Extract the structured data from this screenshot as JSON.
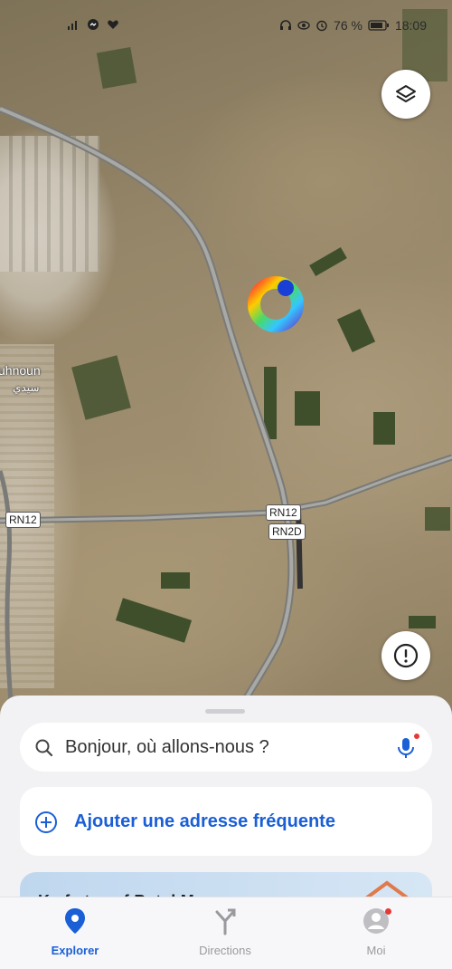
{
  "status_bar": {
    "battery": "76 %",
    "time": "18:09"
  },
  "map": {
    "place_name": "uhnoun",
    "place_name_ar": "سيدي",
    "road_labels": [
      "RN12",
      "RN12",
      "RN2D"
    ],
    "layers_icon": "layers-icon",
    "info_icon": "alert-info-icon"
  },
  "sheet": {
    "search_placeholder": "Bonjour, où allons-nous ?",
    "add_address": "Ajouter une adresse fréquente",
    "promo_text": "K...f...t... ...f B..t..l M..."
  },
  "nav": {
    "items": [
      {
        "label": "Explorer",
        "icon": "location-pin-icon"
      },
      {
        "label": "Directions",
        "icon": "directions-icon"
      },
      {
        "label": "Moi",
        "icon": "profile-icon"
      }
    ]
  },
  "colors": {
    "accent": "#1a5fd6",
    "notification": "#e53935"
  }
}
